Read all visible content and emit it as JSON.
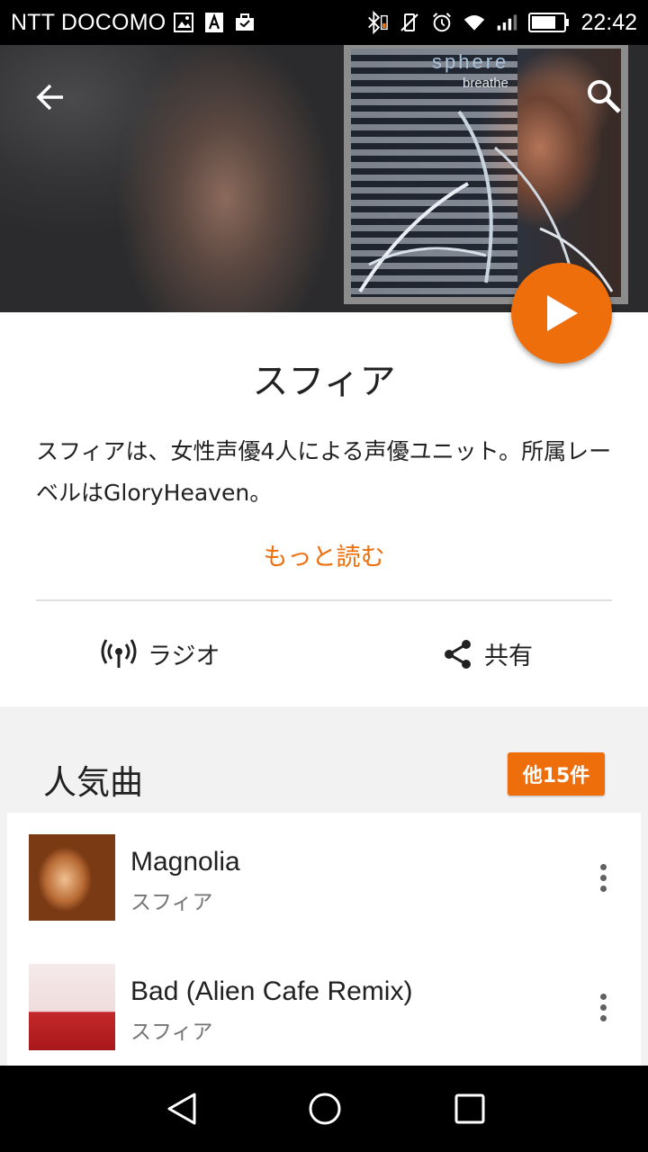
{
  "status_bar": {
    "carrier": "NTT DOCOMO",
    "time": "22:42",
    "icons": [
      "gallery-icon",
      "a-icon",
      "briefcase-icon",
      "bluetooth-icon",
      "vibrate-icon",
      "mute-icon",
      "alarm-icon",
      "wifi-icon",
      "signal-icon",
      "battery-icon"
    ]
  },
  "header": {
    "back_icon": "arrow-back-icon",
    "search_icon": "search-icon",
    "album_art": {
      "title_text": "sphere",
      "subtitle_text": "breathe"
    },
    "play_button_icon": "play-icon"
  },
  "artist": {
    "name": "スフィア",
    "bio": "スフィアは、女性声優4人による声優ユニット。所属レーベルはGloryHeaven。",
    "more_label": "もっと読む"
  },
  "actions": {
    "radio_label": "ラジオ",
    "share_label": "共有"
  },
  "popular": {
    "title": "人気曲",
    "more_badge": "他15件",
    "songs": [
      {
        "title": "Magnolia",
        "artist": "スフィア"
      },
      {
        "title": "Bad (Alien Cafe Remix)",
        "artist": "スフィア"
      }
    ]
  },
  "colors": {
    "accent": "#ee6e0c",
    "text_primary": "#212121",
    "text_secondary": "#757575"
  }
}
